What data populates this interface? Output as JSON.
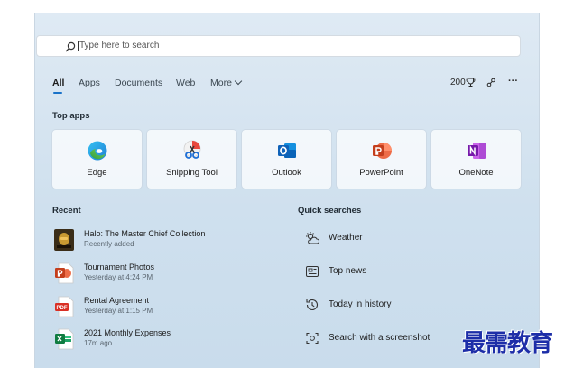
{
  "search": {
    "placeholder": "Type here to search"
  },
  "tabs": [
    {
      "label": "All"
    },
    {
      "label": "Apps"
    },
    {
      "label": "Documents"
    },
    {
      "label": "Web"
    },
    {
      "label": "More"
    }
  ],
  "controls": {
    "points": "200",
    "trophy_icon": "trophy-icon",
    "share_icon": "network-icon",
    "more_label": "···"
  },
  "top_apps": {
    "title": "Top apps",
    "items": [
      {
        "label": "Edge",
        "icon": "edge-icon"
      },
      {
        "label": "Snipping Tool",
        "icon": "snipping-tool-icon"
      },
      {
        "label": "Outlook",
        "icon": "outlook-icon"
      },
      {
        "label": "PowerPoint",
        "icon": "powerpoint-icon"
      },
      {
        "label": "OneNote",
        "icon": "onenote-icon"
      }
    ]
  },
  "recent": {
    "title": "Recent",
    "items": [
      {
        "name": "Halo: The Master Chief Collection",
        "detail": "Recently added",
        "icon": "halo-game-icon"
      },
      {
        "name": "Tournament Photos",
        "detail": "Yesterday at 4:24 PM",
        "icon": "powerpoint-file-icon"
      },
      {
        "name": "Rental Agreement",
        "detail": "Yesterday at 1:15 PM",
        "icon": "pdf-file-icon"
      },
      {
        "name": "2021 Monthly Expenses",
        "detail": "17m ago",
        "icon": "excel-file-icon"
      }
    ]
  },
  "quick_searches": {
    "title": "Quick searches",
    "items": [
      {
        "label": "Weather",
        "icon": "weather-icon"
      },
      {
        "label": "Top news",
        "icon": "news-icon"
      },
      {
        "label": "Today in history",
        "icon": "history-icon"
      },
      {
        "label": "Search with a screenshot",
        "icon": "screenshot-icon"
      }
    ]
  },
  "watermark": "最需教育",
  "colors": {
    "accent": "#1a73c9",
    "panel_top": "#dfeaf4",
    "panel_bottom": "#c9dcec"
  }
}
